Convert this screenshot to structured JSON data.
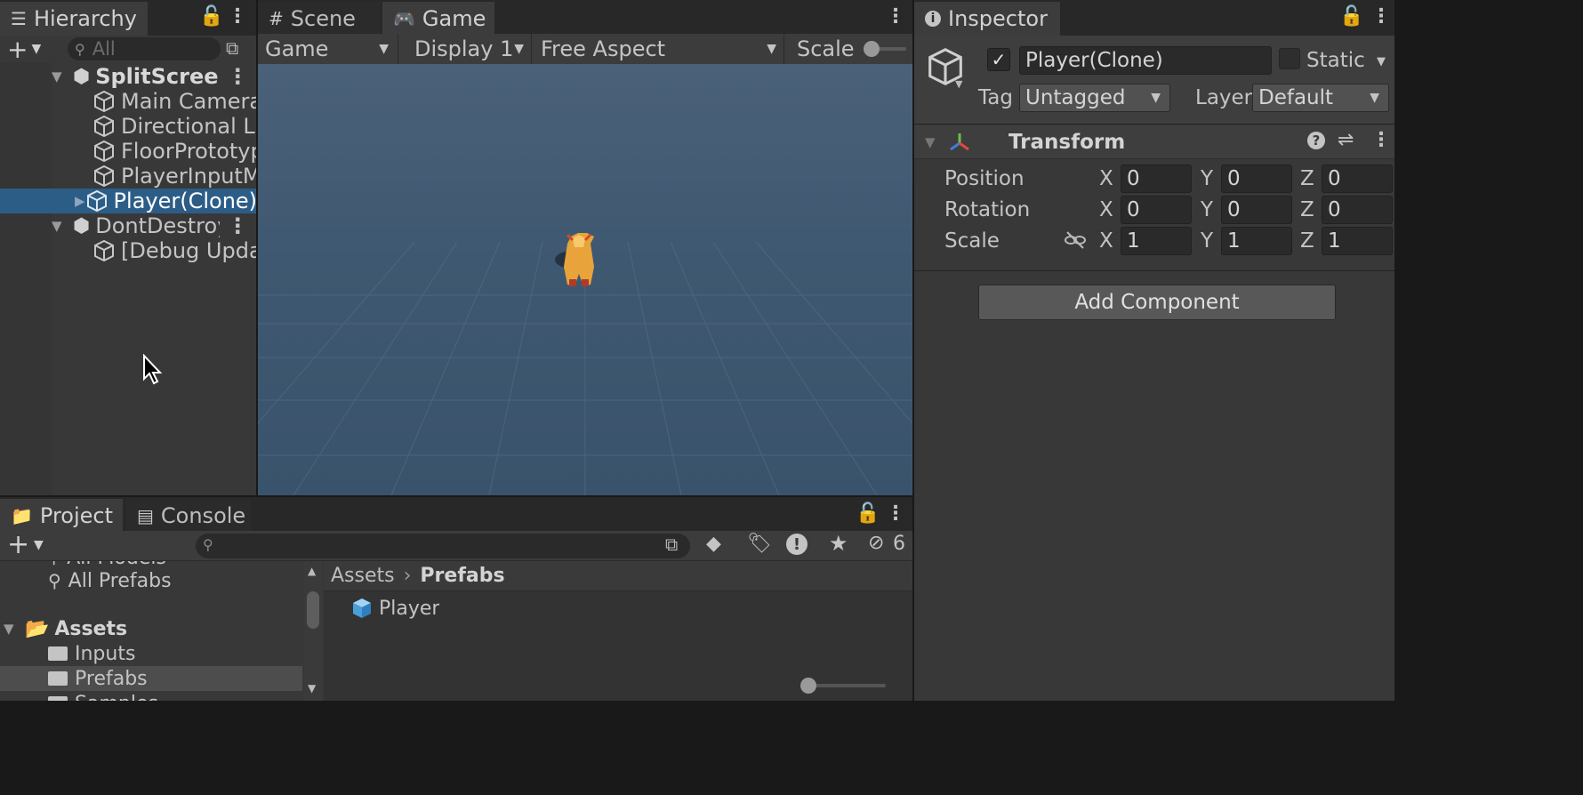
{
  "hierarchy": {
    "tab_label": "Hierarchy",
    "search_placeholder": "All",
    "items": [
      {
        "label": "SplitScreenEx",
        "type": "scene"
      },
      {
        "label": "Main Camera",
        "type": "object"
      },
      {
        "label": "Directional Ligh",
        "type": "object"
      },
      {
        "label": "FloorPrototype(",
        "type": "object"
      },
      {
        "label": "PlayerInputMar",
        "type": "object"
      },
      {
        "label": "Player(Clone)",
        "type": "object",
        "selected": true
      },
      {
        "label": "DontDestroyO",
        "type": "scene"
      },
      {
        "label": "[Debug Update",
        "type": "object"
      }
    ]
  },
  "game_view": {
    "tabs": [
      {
        "label": "Scene",
        "icon": "grid-icon"
      },
      {
        "label": "Game",
        "icon": "gamepad-icon"
      }
    ],
    "toolbar": {
      "mode": "Game",
      "display": "Display 1",
      "aspect": "Free Aspect",
      "scale_label": "Scale"
    }
  },
  "inspector": {
    "tab_label": "Inspector",
    "object_name": "Player(Clone)",
    "active_checked": true,
    "static_label": "Static",
    "tag_label": "Tag",
    "tag_value": "Untagged",
    "layer_label": "Layer",
    "layer_value": "Default",
    "transform": {
      "title": "Transform",
      "rows": [
        {
          "label": "Position",
          "x": "0",
          "y": "0",
          "z": "0"
        },
        {
          "label": "Rotation",
          "x": "0",
          "y": "0",
          "z": "0"
        },
        {
          "label": "Scale",
          "x": "1",
          "y": "1",
          "z": "1"
        }
      ],
      "axis_x": "X",
      "axis_y": "Y",
      "axis_z": "Z"
    },
    "add_component_label": "Add Component"
  },
  "project": {
    "tabs": [
      {
        "label": "Project",
        "icon": "folder-icon"
      },
      {
        "label": "Console",
        "icon": "console-icon"
      }
    ],
    "hidden_count": "6",
    "favorites": {
      "partial_label": "All Models",
      "all_prefabs_label": "All Prefabs"
    },
    "tree": {
      "root": "Assets",
      "children": [
        "Inputs",
        "Prefabs",
        "Samples"
      ]
    },
    "breadcrumb": {
      "root": "Assets",
      "current": "Prefabs"
    },
    "files": [
      {
        "label": "Player",
        "icon": "prefab-icon"
      }
    ]
  },
  "colors": {
    "selection": "#2c5d87",
    "accent_blue": "#5aa0d4",
    "game_bg": "#3d5670"
  }
}
